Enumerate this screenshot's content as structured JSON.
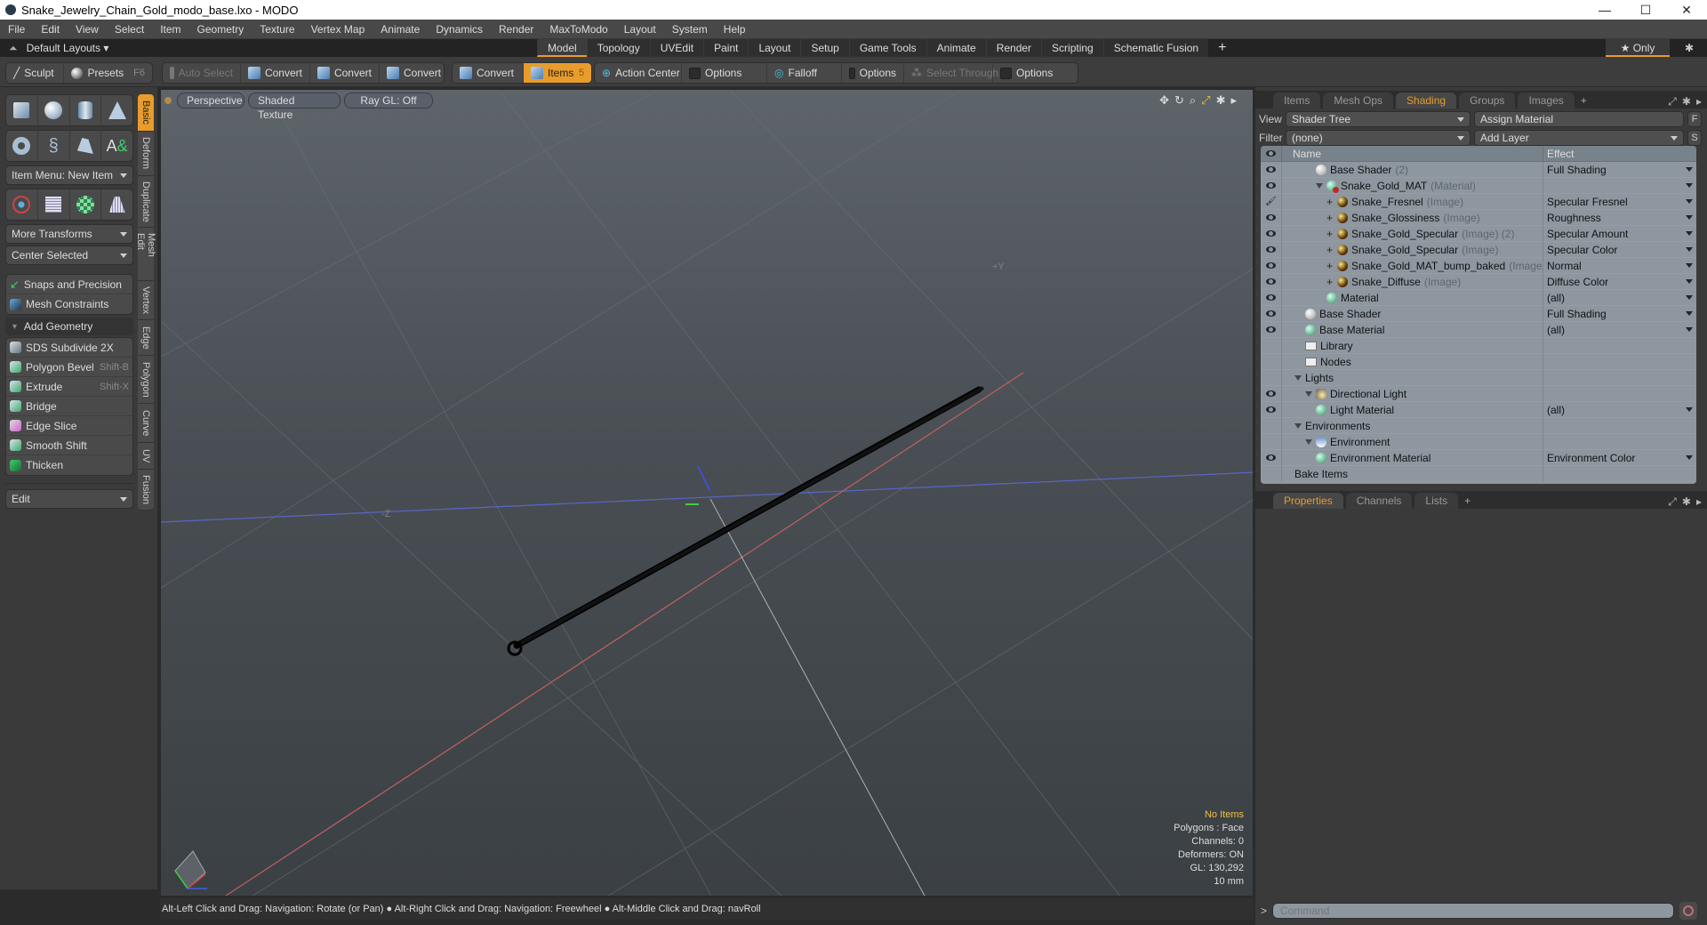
{
  "window": {
    "title": "Snake_Jewelry_Chain_Gold_modo_base.lxo - MODO",
    "controls": {
      "minimize": "—",
      "maximize": "☐",
      "close": "✕"
    }
  },
  "menu": [
    "File",
    "Edit",
    "View",
    "Select",
    "Item",
    "Geometry",
    "Texture",
    "Vertex Map",
    "Animate",
    "Dynamics",
    "Render",
    "MaxToModo",
    "Layout",
    "System",
    "Help"
  ],
  "layoutbar": {
    "default_layouts": "Default Layouts ▾",
    "tabs": [
      "Model",
      "Topology",
      "UVEdit",
      "Paint",
      "Layout",
      "Setup",
      "Game Tools",
      "Animate",
      "Render",
      "Scripting",
      "Schematic Fusion"
    ],
    "active_tab": "Model",
    "plus": "+",
    "only_label": "★ Only",
    "gear": "✱"
  },
  "toolbar": {
    "sculpt": "Sculpt",
    "presets": "Presets",
    "presets_key": "F6",
    "auto_select": "Auto Select",
    "convert": [
      "Convert",
      "Convert",
      "Convert",
      "Convert"
    ],
    "items": "Items",
    "items_count": "5",
    "action_center": "Action Center",
    "options1": "Options",
    "falloff": "Falloff",
    "options2": "Options",
    "select_through": "Select Through",
    "options3": "Options"
  },
  "leftpanel": {
    "item_menu": "Item Menu: New Item",
    "more_transforms": "More Transforms",
    "center_selected": "Center Selected",
    "snaps": "Snaps and Precision",
    "mesh_constraints": "Mesh Constraints",
    "add_geometry": "Add Geometry",
    "tools": [
      {
        "label": "SDS Subdivide 2X",
        "key": ""
      },
      {
        "label": "Polygon Bevel",
        "key": "Shift-B"
      },
      {
        "label": "Extrude",
        "key": "Shift-X"
      },
      {
        "label": "Bridge",
        "key": ""
      },
      {
        "label": "Edge Slice",
        "key": ""
      },
      {
        "label": "Smooth Shift",
        "key": ""
      },
      {
        "label": "Thicken",
        "key": ""
      }
    ],
    "edit": "Edit",
    "vtabs": [
      "Basic",
      "Deform",
      "Duplicate",
      "Mesh Edit",
      "Vertex",
      "Edge",
      "Polygon",
      "Curve",
      "UV",
      "Fusion"
    ],
    "active_vtab": "Basic"
  },
  "viewport": {
    "view": "Perspective",
    "shading": "Shaded Texture",
    "raygl": "Ray GL: Off",
    "axis_labels": {
      "plus_y": "+Y",
      "minus_z": "-Z"
    },
    "stats": {
      "items": "No Items",
      "polygons": "Polygons : Face",
      "channels": "Channels: 0",
      "deformers": "Deformers: ON",
      "gl": "GL: 130,292",
      "unit": "10 mm"
    }
  },
  "statusbar": {
    "hint": "Alt-Left Click and Drag: Navigation: Rotate (or Pan) ● Alt-Right Click and Drag: Navigation: Freewheel ● Alt-Middle Click and Drag: navRoll"
  },
  "rightpanel": {
    "tabs": [
      "Items",
      "Mesh Ops",
      "Shading",
      "Groups",
      "Images"
    ],
    "active_tab": "Shading",
    "view_label": "View",
    "view_value": "Shader Tree",
    "assign_material": "Assign Material",
    "f_btn": "F",
    "filter_label": "Filter",
    "filter_value": "(none)",
    "add_layer": "Add Layer",
    "s_btn": "S",
    "columns": {
      "name": "Name",
      "effect": "Effect"
    },
    "rows": [
      {
        "indent": 2,
        "icon": "white",
        "name": "Base Shader",
        "suffix": "(2)",
        "effect": "Full Shading",
        "eye": "eye",
        "dd": true
      },
      {
        "indent": 2,
        "icon": "mat",
        "name": "Snake_Gold_MAT",
        "suffix": "(Material)",
        "effect": "",
        "eye": "eye",
        "dd": true,
        "tri": true
      },
      {
        "indent": 3,
        "icon": "img",
        "name": "Snake_Fresnel",
        "suffix": "(Image)",
        "effect": "Specular Fresnel",
        "eye": "brush",
        "dd": true,
        "plus": true
      },
      {
        "indent": 3,
        "icon": "img",
        "name": "Snake_Glossiness",
        "suffix": "(Image)",
        "effect": "Roughness",
        "eye": "eye",
        "dd": true,
        "plus": true
      },
      {
        "indent": 3,
        "icon": "img",
        "name": "Snake_Gold_Specular",
        "suffix": "(Image) (2)",
        "effect": "Specular Amount",
        "eye": "eye",
        "dd": true,
        "plus": true
      },
      {
        "indent": 3,
        "icon": "img",
        "name": "Snake_Gold_Specular",
        "suffix": "(Image)",
        "effect": "Specular Color",
        "eye": "eye",
        "dd": true,
        "plus": true
      },
      {
        "indent": 3,
        "icon": "img",
        "name": "Snake_Gold_MAT_bump_baked",
        "suffix": "(Image)",
        "effect": "Normal",
        "eye": "eye",
        "dd": true,
        "plus": true
      },
      {
        "indent": 3,
        "icon": "img",
        "name": "Snake_Diffuse",
        "suffix": "(Image)",
        "effect": "Diffuse Color",
        "eye": "eye",
        "dd": true,
        "plus": true
      },
      {
        "indent": 3,
        "icon": "green",
        "name": "Material",
        "suffix": "",
        "effect": "(all)",
        "eye": "eye",
        "dd": true
      },
      {
        "indent": 1,
        "icon": "white",
        "name": "Base Shader",
        "suffix": "",
        "effect": "Full Shading",
        "eye": "eye",
        "dd": true
      },
      {
        "indent": 1,
        "icon": "green",
        "name": "Base Material",
        "suffix": "",
        "effect": "(all)",
        "eye": "eye",
        "dd": true
      },
      {
        "indent": 1,
        "icon": "folder",
        "name": "Library",
        "suffix": "",
        "effect": "",
        "eye": ""
      },
      {
        "indent": 1,
        "icon": "folder",
        "name": "Nodes",
        "suffix": "",
        "effect": "",
        "eye": ""
      },
      {
        "indent": 0,
        "icon": "",
        "name": "Lights",
        "suffix": "",
        "effect": "",
        "eye": "",
        "tri": true
      },
      {
        "indent": 1,
        "icon": "light",
        "name": "Directional Light",
        "suffix": "",
        "effect": "",
        "eye": "eye",
        "tri": true
      },
      {
        "indent": 2,
        "icon": "green",
        "name": "Light Material",
        "suffix": "",
        "effect": "(all)",
        "eye": "eye",
        "dd": true
      },
      {
        "indent": 0,
        "icon": "",
        "name": "Environments",
        "suffix": "",
        "effect": "",
        "eye": "",
        "tri": true
      },
      {
        "indent": 1,
        "icon": "env",
        "name": "Environment",
        "suffix": "",
        "effect": "",
        "eye": "",
        "tri": true
      },
      {
        "indent": 2,
        "icon": "green",
        "name": "Environment Material",
        "suffix": "",
        "effect": "Environment Color",
        "eye": "eye",
        "dd": true
      },
      {
        "indent": 0,
        "icon": "",
        "name": "Bake Items",
        "suffix": "",
        "effect": "",
        "eye": ""
      }
    ],
    "prop_tabs": [
      "Properties",
      "Channels",
      "Lists"
    ],
    "active_prop_tab": "Properties",
    "command_prompt": ">",
    "command_placeholder": "Command"
  },
  "colors": {
    "accent": "#e89c2c",
    "stats_highlight": "#f0c040",
    "tree_bg": "#8e979f"
  }
}
